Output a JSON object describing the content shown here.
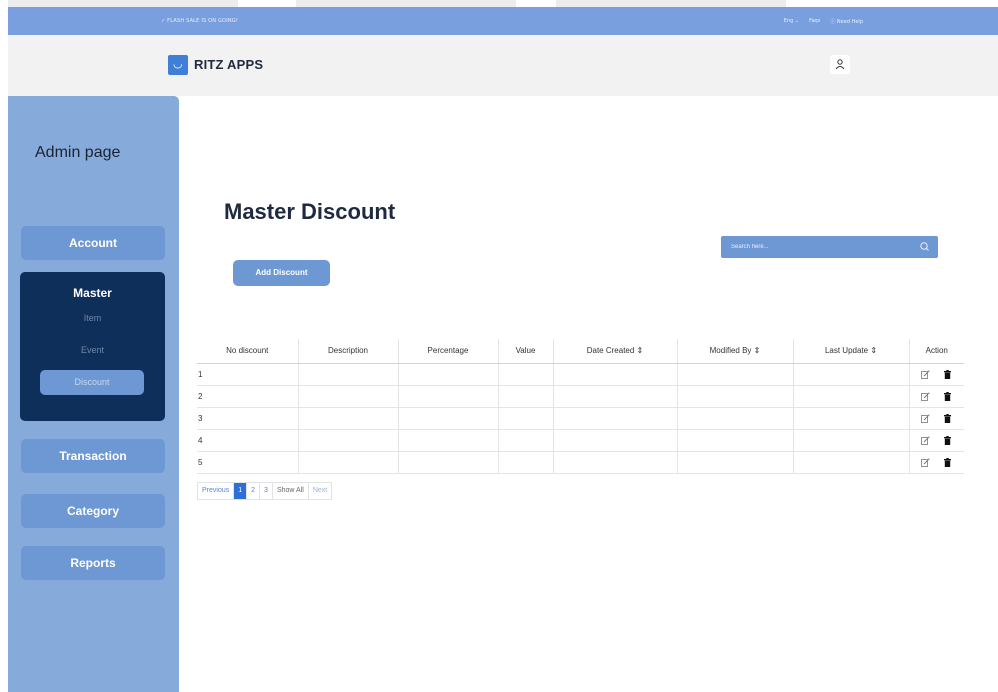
{
  "announcement": {
    "message": "✓ FLASH SALE IS ON GOING!",
    "language": "Eng ⌄",
    "faqs": "Faqs",
    "help": "ⓘ Need Help"
  },
  "header": {
    "brand": "RITZ APPS",
    "logo_icon": "shopping-bag-icon",
    "user_icon": "user-icon"
  },
  "sidebar": {
    "title": "Admin page",
    "account_label": "Account",
    "master": {
      "label": "Master",
      "items": [
        "Item",
        "Event",
        "Discount"
      ],
      "active": "Discount"
    },
    "transaction_label": "Transaction",
    "category_label": "Category",
    "reports_label": "Reports"
  },
  "main": {
    "title": "Master Discount",
    "add_button_label": "Add Discount",
    "search": {
      "placeholder": "Search here...",
      "icon": "search-icon"
    }
  },
  "table": {
    "columns": [
      "No discount",
      "Description",
      "Percentage",
      "Value",
      "Date Created ⇕",
      "Modified By ⇕",
      "Last Update ⇕",
      "Action"
    ],
    "rows": [
      {
        "no": "1"
      },
      {
        "no": "2"
      },
      {
        "no": "3"
      },
      {
        "no": "4"
      },
      {
        "no": "5"
      }
    ]
  },
  "pagination": {
    "previous": "Previous",
    "pages": [
      "1",
      "2",
      "3"
    ],
    "active_page": "1",
    "show_all": "Show All",
    "next": "Next"
  },
  "colors": {
    "announce": "#7a9fdf",
    "sidebar": "#86abdb",
    "button": "#6e98d3",
    "master_panel": "#0f2f5b",
    "page_active": "#2d6fd6"
  }
}
